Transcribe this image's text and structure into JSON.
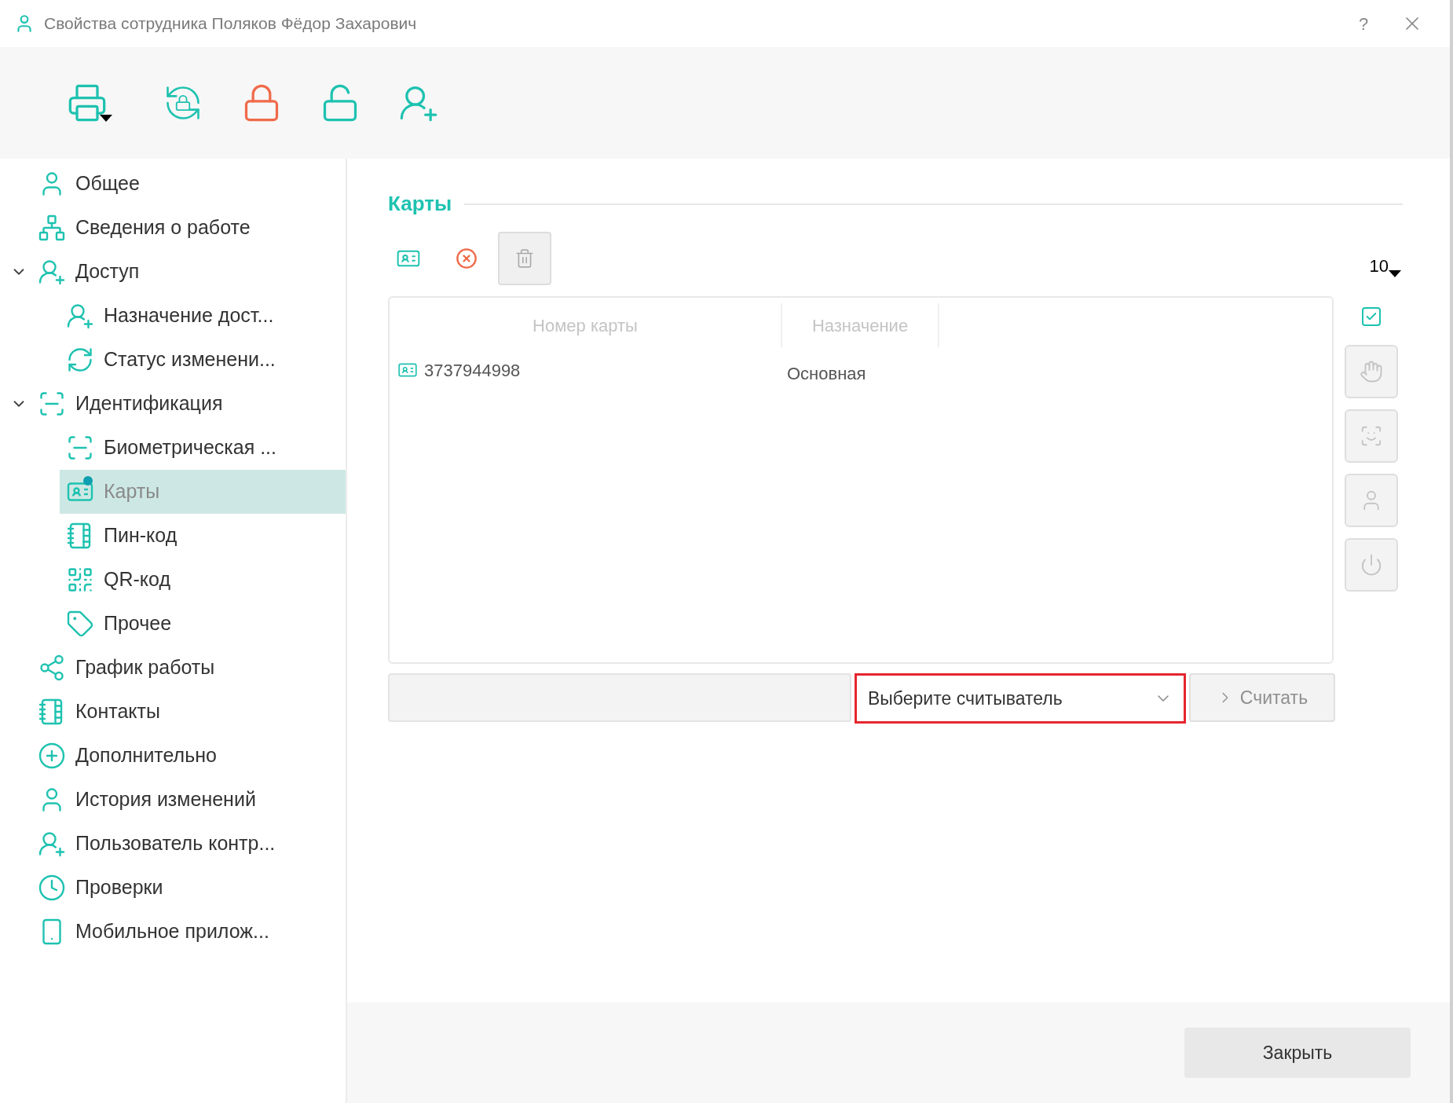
{
  "window": {
    "title": "Свойства сотрудника Поляков Фёдор Захарович",
    "help": "?"
  },
  "toolbar": [
    {
      "kind": "print",
      "disabled": false
    },
    {
      "kind": "relock",
      "disabled": false
    },
    {
      "kind": "lock",
      "disabled": false
    },
    {
      "kind": "unlock",
      "disabled": false
    },
    {
      "kind": "adduser",
      "disabled": false
    }
  ],
  "sidebar": {
    "items": [
      {
        "label": "Общее",
        "kind": "user",
        "selected": false,
        "marked": false
      },
      {
        "label": "Сведения о работе",
        "kind": "org",
        "selected": false,
        "marked": false
      },
      {
        "label": "Доступ",
        "kind": "access",
        "selected": false,
        "marked": false,
        "expanded": true,
        "children": [
          {
            "label": "Назначение дост...",
            "kind": "access",
            "selected": false,
            "marked": false
          },
          {
            "label": "Статус изменени...",
            "kind": "sync",
            "selected": false,
            "marked": false
          }
        ]
      },
      {
        "label": "Идентификация",
        "kind": "scan",
        "selected": false,
        "marked": false,
        "expanded": true,
        "children": [
          {
            "label": "Биометрическая ...",
            "kind": "scan",
            "selected": false,
            "marked": false
          },
          {
            "label": "Карты",
            "kind": "card",
            "selected": true,
            "marked": true
          },
          {
            "label": "Пин-код",
            "kind": "book",
            "selected": false,
            "marked": false
          },
          {
            "label": "QR-код",
            "kind": "qr",
            "selected": false,
            "marked": false
          },
          {
            "label": "Прочее",
            "kind": "tag",
            "selected": false,
            "marked": false
          }
        ]
      },
      {
        "label": "График работы",
        "kind": "share",
        "selected": false,
        "marked": false
      },
      {
        "label": "Контакты",
        "kind": "book",
        "selected": false,
        "marked": false
      },
      {
        "label": "Дополнительно",
        "kind": "plus",
        "selected": false,
        "marked": false
      },
      {
        "label": "История изменений",
        "kind": "user",
        "selected": false,
        "marked": false
      },
      {
        "label": "Пользователь контр...",
        "kind": "adduser",
        "selected": false,
        "marked": false
      },
      {
        "label": "Проверки",
        "kind": "clock",
        "selected": false,
        "marked": false
      },
      {
        "label": "Мобильное прилож...",
        "kind": "phone",
        "selected": false,
        "marked": false
      }
    ]
  },
  "cards": {
    "title": "Карты",
    "actions": [
      {
        "kind": "add",
        "disabled": false
      },
      {
        "kind": "cancel",
        "disabled": false
      },
      {
        "kind": "delete",
        "disabled": true
      }
    ],
    "page_size": "10",
    "table": {
      "columns": [
        "Номер карты",
        "Назначение"
      ],
      "rows": [
        {
          "cells": [
            "3737944998",
            "Основная"
          ],
          "selected": false
        }
      ]
    },
    "select_all": {
      "checked": true
    },
    "side_buttons": [
      {
        "kind": "finger",
        "disabled": true
      },
      {
        "kind": "face",
        "disabled": true
      },
      {
        "kind": "user",
        "disabled": true
      },
      {
        "kind": "power",
        "disabled": true
      }
    ],
    "reader": {
      "select": "Выберите считыватель",
      "highlighted": true,
      "read_button": "Считать",
      "read_disabled": true
    }
  },
  "footer": {
    "close_button": "Закрыть"
  }
}
